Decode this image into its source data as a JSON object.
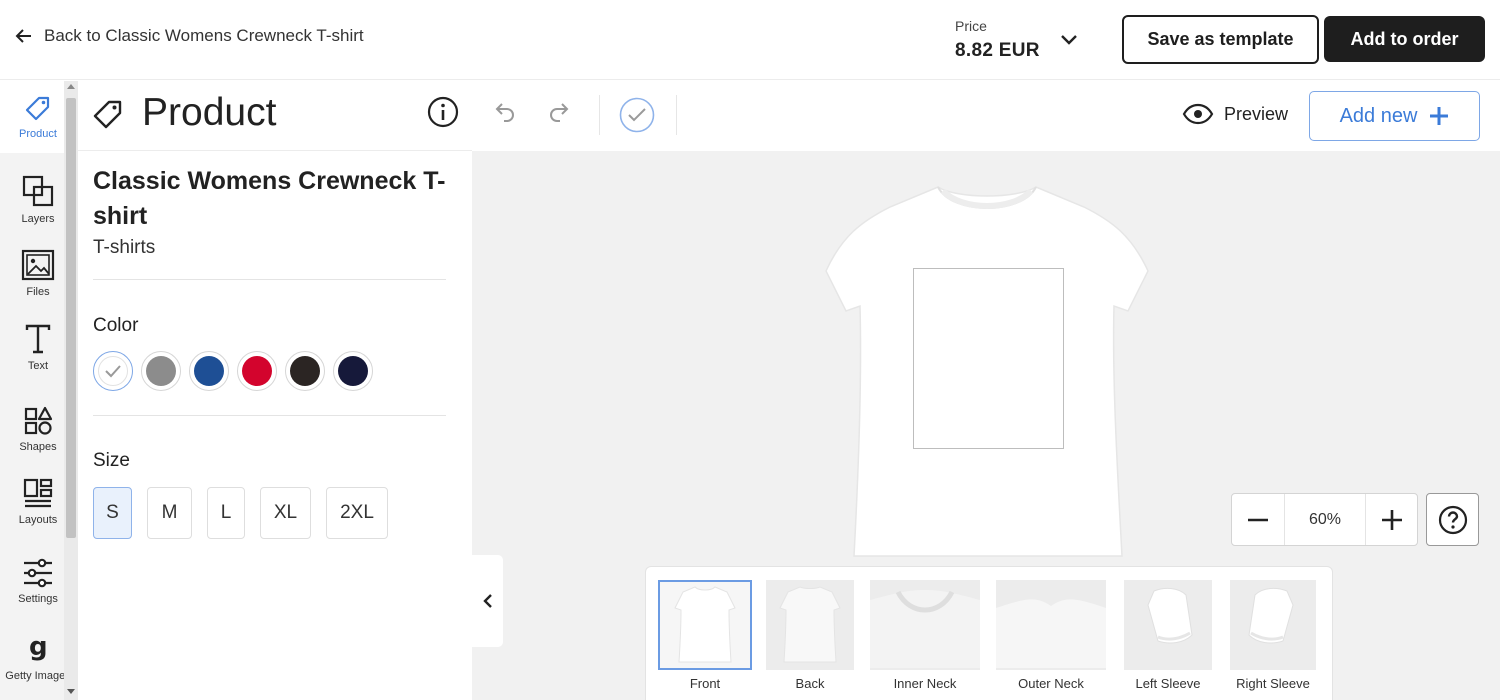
{
  "header": {
    "back_label": "Back to Classic Womens Crewneck T-shirt",
    "price_label": "Price",
    "price_value": "8.82 EUR",
    "save_template_label": "Save as template",
    "add_to_order_label": "Add to order"
  },
  "sidebar": {
    "items": [
      {
        "label": "Product",
        "icon": "tag-icon"
      },
      {
        "label": "Layers",
        "icon": "layers-icon"
      },
      {
        "label": "Files",
        "icon": "image-icon"
      },
      {
        "label": "Text",
        "icon": "text-icon"
      },
      {
        "label": "Shapes",
        "icon": "shapes-icon"
      },
      {
        "label": "Layouts",
        "icon": "layouts-icon"
      },
      {
        "label": "Settings",
        "icon": "sliders-icon"
      },
      {
        "label": "Getty Images",
        "icon": "getty-icon"
      }
    ],
    "active": "Product"
  },
  "panel": {
    "title": "Product",
    "product_name": "Classic Womens Crewneck T-shirt",
    "category": "T-shirts",
    "color_label": "Color",
    "colors": [
      {
        "name": "white",
        "hex": "#ffffff",
        "selected": true
      },
      {
        "name": "grey",
        "hex": "#8c8c8c",
        "selected": false
      },
      {
        "name": "royal",
        "hex": "#1e4f95",
        "selected": false
      },
      {
        "name": "red",
        "hex": "#d3042d",
        "selected": false
      },
      {
        "name": "black",
        "hex": "#2b2523",
        "selected": false
      },
      {
        "name": "navy",
        "hex": "#16193a",
        "selected": false
      }
    ],
    "size_label": "Size",
    "sizes": [
      "S",
      "M",
      "L",
      "XL",
      "2XL"
    ],
    "selected_size": "S"
  },
  "toolbar": {
    "preview_label": "Preview",
    "add_new_label": "Add new"
  },
  "canvas": {
    "zoom_value": "60%"
  },
  "views": {
    "items": [
      "Front",
      "Back",
      "Inner Neck",
      "Outer Neck",
      "Left Sleeve",
      "Right Sleeve"
    ],
    "selected": "Front"
  },
  "colors": {
    "accent": "#3b7bd8",
    "dark": "#1e1e1e"
  }
}
